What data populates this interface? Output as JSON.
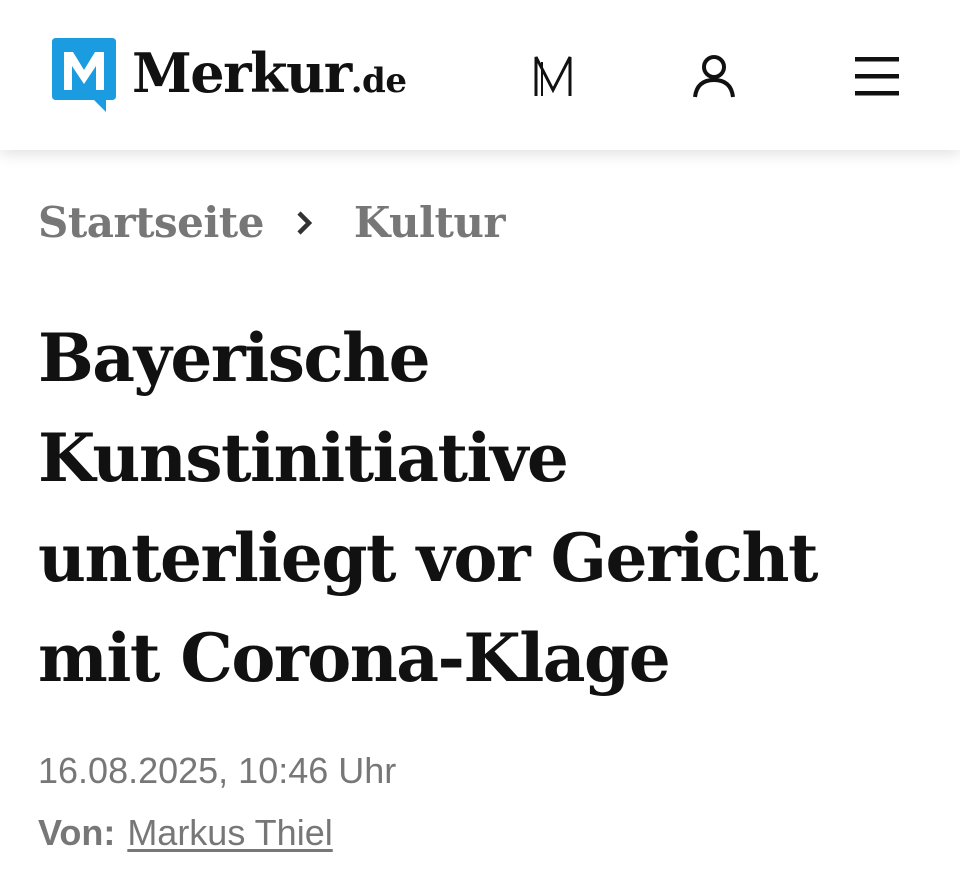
{
  "header": {
    "logo_word": "Merkur",
    "logo_tld": ".de",
    "icons": [
      "merkur-m-icon",
      "user-icon",
      "menu-icon"
    ],
    "brand_color": "#1c9ce0"
  },
  "breadcrumb": {
    "items": [
      "Startseite",
      "Kultur"
    ]
  },
  "article": {
    "headline_lines": [
      "Bayerische",
      "Kunstinitiative",
      "unterliegt vor Gericht",
      "mit Corona-Klage"
    ],
    "date": "16.08.2025, 10:46 Uhr",
    "author_label": "Von:",
    "author_name": "Markus Thiel"
  }
}
